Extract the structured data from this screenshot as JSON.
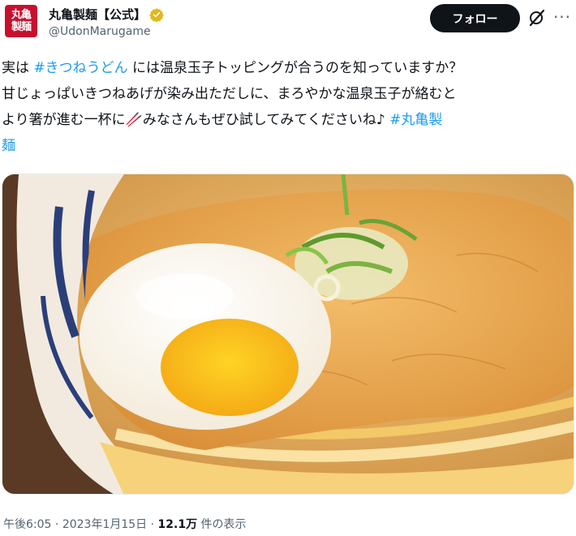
{
  "account": {
    "avatar_line1": "丸亀",
    "avatar_line2": "製麺",
    "display_name": "丸亀製麺【公式】",
    "handle": "@UdonMarugame",
    "verified_color": "#e2b719"
  },
  "actions": {
    "follow_label": "フォロー",
    "grok_icon": "grok-icon",
    "more_icon": "more-icon"
  },
  "tweet": {
    "line1_a": "実は ",
    "hashtag1": "#きつねうどん",
    "line1_b": " には温泉玉子トッピングが合うのを知っていますか？",
    "line2": "甘じょっぱいきつねあげが染み出ただしに、まろやかな温泉玉子が絡むと",
    "line3_a": "より箸が進む一杯に",
    "chopsticks_emoji": "🥢",
    "line3_b": "みなさんもぜひ試してみてくださいね♪ ",
    "hashtag2_part1": "#丸亀製",
    "hashtag2_part2": "麺"
  },
  "media": {
    "description_icon": "kitsune-udon-photo"
  },
  "meta": {
    "time": "午後6:05",
    "separator1": " · ",
    "date": "2023年1月15日",
    "separator2": " · ",
    "views_count": "12.1万",
    "views_label": " 件の表示"
  },
  "colors": {
    "hashtag": "#1d9bf0",
    "follow_bg": "#0f1419",
    "brand_red": "#c8102e"
  }
}
